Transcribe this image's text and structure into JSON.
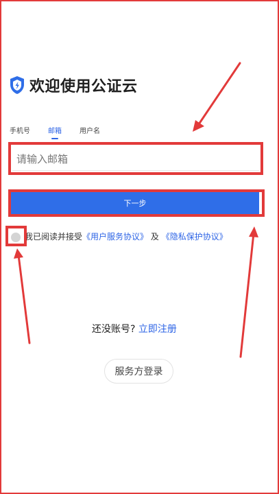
{
  "header": {
    "title": "欢迎使用公证云",
    "logo_icon": "shield-bolt-icon"
  },
  "tabs": [
    {
      "label": "手机号",
      "active": false
    },
    {
      "label": "邮箱",
      "active": true
    },
    {
      "label": "用户名",
      "active": false
    }
  ],
  "email_input": {
    "placeholder": "请输入邮箱",
    "value": ""
  },
  "next_button": {
    "label": "下一步"
  },
  "agreement": {
    "prefix": "我已阅读并接受",
    "terms_link": "《用户服务协议》",
    "joiner": "及",
    "privacy_link": "《隐私保护协议》",
    "checked": false
  },
  "register": {
    "prompt": "还没账号?",
    "link": "立即注册"
  },
  "provider_login": {
    "label": "服务方登录"
  },
  "colors": {
    "accent": "#2f6ee8",
    "annotation": "#e23a3a"
  }
}
